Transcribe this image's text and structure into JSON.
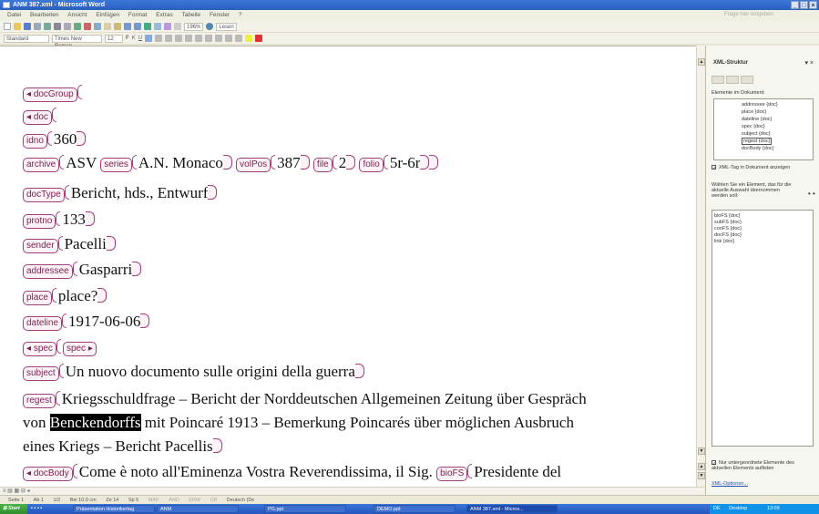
{
  "window": {
    "title": "ANM 387.xml - Microsoft Word"
  },
  "menu": [
    "Datei",
    "Bearbeiten",
    "Ansicht",
    "Einfügen",
    "Format",
    "Extras",
    "Tabelle",
    "Fenster",
    "?"
  ],
  "ask_placeholder": "Frage hier eingeben",
  "toolbar": {
    "zoom": "196%",
    "read_label": "Lesen",
    "style": "Standard",
    "font": "Times New Roman",
    "size": "12"
  },
  "doc": {
    "docGroup": "docGroup",
    "doc": "doc",
    "idno_tag": "idno",
    "idno": "360",
    "archive_tag": "archive",
    "archive": "ASV",
    "series_tag": "series",
    "series": "A.N. Monaco",
    "volPos_tag": "volPos",
    "volPos": "387",
    "file_tag": "file",
    "file": "2",
    "folio_tag": "folio",
    "folio": "5r-6r",
    "docType_tag": "docType",
    "docType": "Bericht, hds., Entwurf",
    "protno_tag": "protno",
    "protno": "133",
    "sender_tag": "sender",
    "sender": "Pacelli",
    "addressee_tag": "addressee",
    "addressee": "Gasparri",
    "place_tag": "place",
    "place": "place?",
    "dateline_tag": "dateline",
    "dateline": "1917-06-06",
    "spec_open": "spec",
    "spec_close": "spec",
    "subject_tag": "subject",
    "subject": "Un nuovo documento sulle origini della guerra",
    "regest_tag": "regest",
    "regest_1": "Kriegsschuldfrage – Bericht der Norddeutschen Allgemeinen Zeitung über Gespräch",
    "regest_2a": "von ",
    "regest_hl": "Benckendorffs",
    "regest_2b": " mit Poincaré 1913 – Bemerkung Poincarés über möglichen Ausbruch",
    "regest_3": "eines Kriegs – Bericht Pacellis",
    "docBody_tag": "docBody",
    "docBody": "Come è noto all'Eminenza Vostra Reverendissima, il Sig. ",
    "bioFS_tag": "bioFS",
    "bioFS": "Presidente del"
  },
  "pane": {
    "title": "XML-Struktur",
    "elements_label": "Elemente im Dokument:",
    "tree": [
      "addressee {doc}",
      "place {doc}",
      "dateline {doc}",
      "spec {doc}",
      "subject {doc}",
      "regest {doc}",
      "docBody {doc}"
    ],
    "show_tags": "XML-Tag in Dokument anzeigen",
    "choose_label": "Wählen Sie ein Element, das für die aktuelle Auswahl übernommen werden soll:",
    "element_list": [
      "bioFS {doc}",
      "subFS {doc}",
      "conFS {doc}",
      "docFS {doc}",
      "link {doc}"
    ],
    "only_children": "Nur untergeordnete Elemente des aktuellen Elements auflisten",
    "options": "XML-Optionen..."
  },
  "status": [
    "Seite 1",
    "Ab 1",
    "1/2",
    "Bei 10.0 cm",
    "Ze 14",
    "Sp 5",
    "MAK",
    "ÄND",
    "ERW",
    "ÜB",
    "Deutsch (De"
  ],
  "taskbar": {
    "start": "Start",
    "tasks": [
      "Präsentation Historikertag",
      "ANM",
      "PG.ppt",
      "DEMO.ppt",
      "ANM 387.xml - Micros..."
    ],
    "tray_lang": "DE",
    "tray_desktop": "Desktop",
    "time": "13:09"
  },
  "colors": {
    "tag_border": "#a0417a",
    "tag_text": "#7a1f4c",
    "title_bar": "#2a5fbf"
  }
}
